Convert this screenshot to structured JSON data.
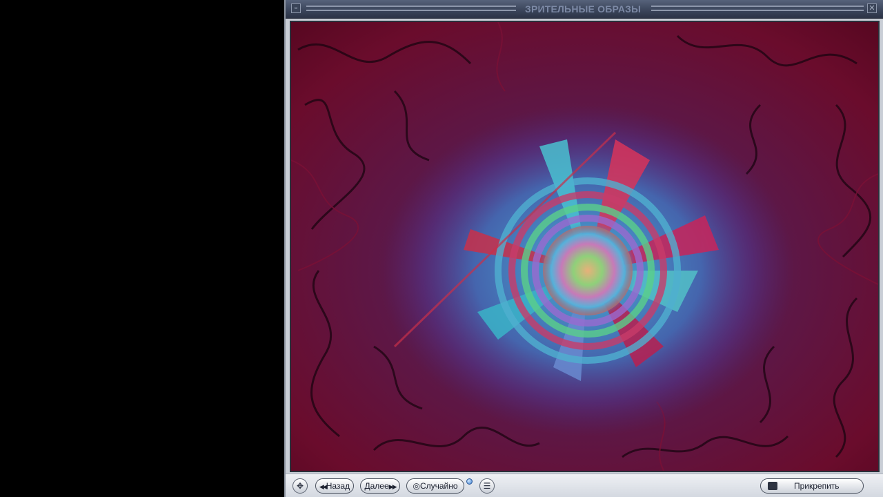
{
  "window": {
    "title": "ЗРИТЕЛЬНЫЕ ОБРАЗЫ",
    "menu_icon": "window-menu-icon",
    "close_icon": "close-icon"
  },
  "toolbar": {
    "back_label": "Назад",
    "next_label": "Далее",
    "random_label": "Случайно",
    "dock_label": "Прикрепить",
    "move_icon": "move-icon",
    "list_icon": "list-icon",
    "dock_icon": "dock-icon"
  },
  "colors": {
    "viz_background": "#5a0a25",
    "title_text": "#7c89a5"
  }
}
